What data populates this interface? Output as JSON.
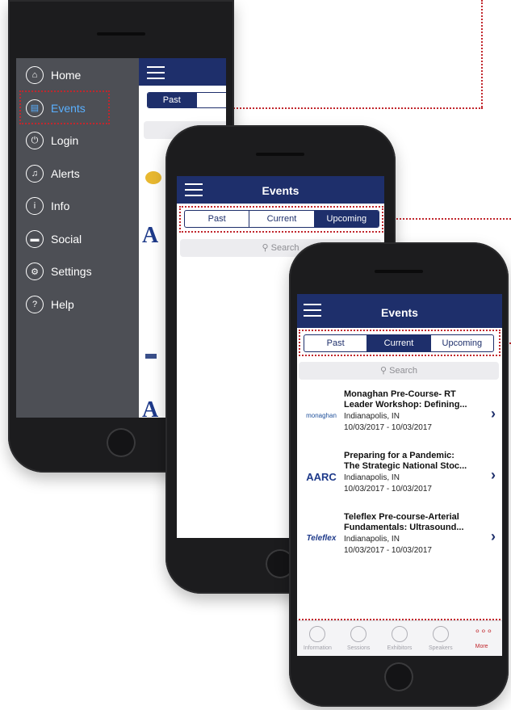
{
  "colors": {
    "navy": "#1e2f6b",
    "annotation": "#c1272d",
    "menu_bg": "#4d4f55"
  },
  "phone1": {
    "menu": [
      {
        "label": "Home",
        "icon": "home-icon",
        "glyph": "⌂"
      },
      {
        "label": "Events",
        "icon": "calendar-icon",
        "glyph": "▤"
      },
      {
        "label": "Login",
        "icon": "power-icon",
        "glyph": "⏻"
      },
      {
        "label": "Alerts",
        "icon": "bell-icon",
        "glyph": "♫"
      },
      {
        "label": "Info",
        "icon": "info-icon",
        "glyph": "i"
      },
      {
        "label": "Social",
        "icon": "chat-icon",
        "glyph": "▬"
      },
      {
        "label": "Settings",
        "icon": "gear-icon",
        "glyph": "⚙"
      },
      {
        "label": "Help",
        "icon": "help-icon",
        "glyph": "?"
      }
    ],
    "behind": {
      "tab_past": "Past"
    }
  },
  "phone2": {
    "title": "Events",
    "tabs": [
      "Past",
      "Current",
      "Upcoming"
    ],
    "active_tab": "Upcoming",
    "search_placeholder": "Search"
  },
  "phone3": {
    "title": "Events",
    "tabs": [
      "Past",
      "Current",
      "Upcoming"
    ],
    "active_tab": "Current",
    "search_placeholder": "Search",
    "events": [
      {
        "logo": "monaghan",
        "title1": "Monaghan Pre-Course- RT",
        "title2": "Leader Workshop:  Defining...",
        "location": "Indianapolis, IN",
        "dates": "10/03/2017 - 10/03/2017"
      },
      {
        "logo": "AARC",
        "title1": "Preparing for a Pandemic:",
        "title2": "The Strategic National Stoc...",
        "location": "Indianapolis, IN",
        "dates": "10/03/2017 - 10/03/2017"
      },
      {
        "logo": "Teleflex",
        "title1": "Teleflex Pre-course-Arterial",
        "title2": "Fundamentals: Ultrasound...",
        "location": "Indianapolis, IN",
        "dates": "10/03/2017 - 10/03/2017"
      }
    ],
    "tabbar": [
      {
        "label": "Information",
        "icon": "info-icon"
      },
      {
        "label": "Sessions",
        "icon": "presentation-icon"
      },
      {
        "label": "Exhibitors",
        "icon": "person-icon"
      },
      {
        "label": "Speakers",
        "icon": "people-icon"
      },
      {
        "label": "More",
        "icon": "more-icon",
        "active": true
      }
    ]
  }
}
